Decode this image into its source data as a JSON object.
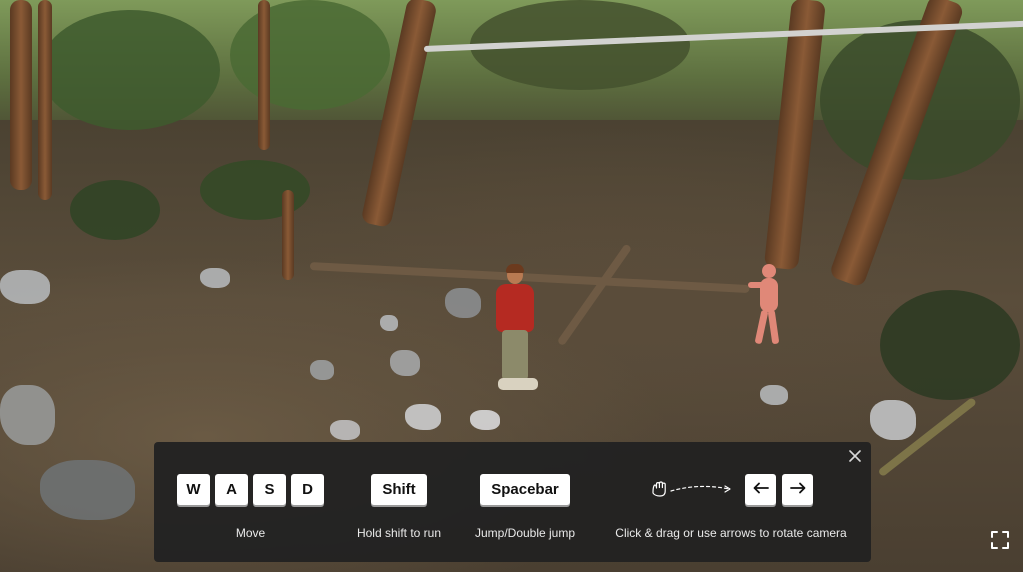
{
  "scene": {
    "description_icon": "forest-scene"
  },
  "controls": {
    "move": {
      "keys": [
        "W",
        "A",
        "S",
        "D"
      ],
      "label": "Move"
    },
    "run": {
      "key": "Shift",
      "label": "Hold shift to run"
    },
    "jump": {
      "key": "Spacebar",
      "label": "Jump/Double jump"
    },
    "camera": {
      "label": "Click & drag or use arrows to rotate camera",
      "drag_icon": "hand-drag-icon",
      "left_icon": "arrow-left-icon",
      "right_icon": "arrow-right-icon"
    },
    "close_icon": "close-icon"
  },
  "fullscreen_icon": "fullscreen-icon",
  "colors": {
    "panel_bg": "#222222",
    "key_bg": "#ffffff",
    "player_sweater": "#b52a22",
    "npc_skin": "#e08878"
  }
}
